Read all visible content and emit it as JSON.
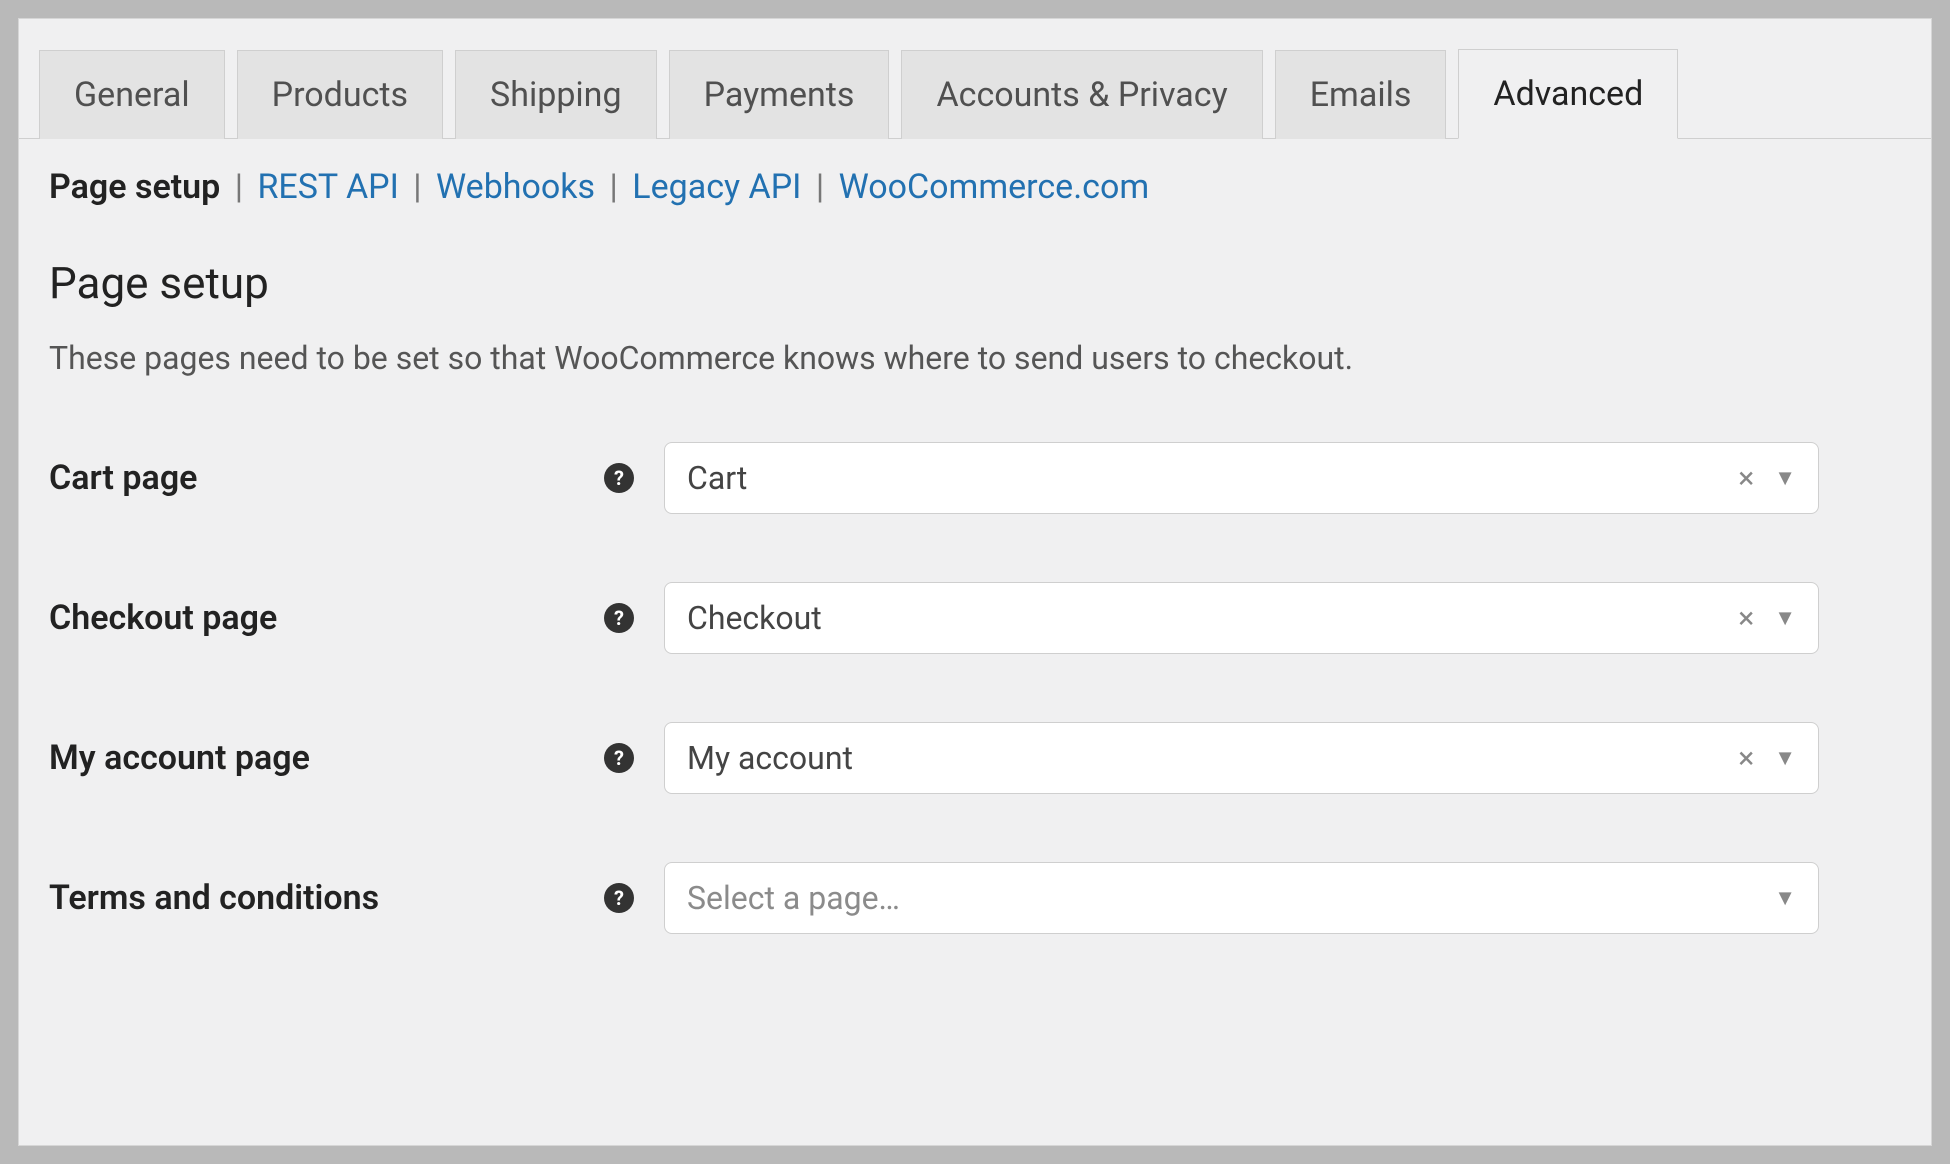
{
  "tabs": [
    {
      "label": "General",
      "active": false
    },
    {
      "label": "Products",
      "active": false
    },
    {
      "label": "Shipping",
      "active": false
    },
    {
      "label": "Payments",
      "active": false
    },
    {
      "label": "Accounts & Privacy",
      "active": false
    },
    {
      "label": "Emails",
      "active": false
    },
    {
      "label": "Advanced",
      "active": true
    }
  ],
  "subnav": {
    "current": "Page setup",
    "items": [
      {
        "label": "REST API"
      },
      {
        "label": "Webhooks"
      },
      {
        "label": "Legacy API"
      },
      {
        "label": "WooCommerce.com"
      }
    ]
  },
  "section": {
    "title": "Page setup",
    "description": "These pages need to be set so that WooCommerce knows where to send users to checkout."
  },
  "fields": {
    "cart": {
      "label": "Cart page",
      "value": "Cart",
      "placeholder": "",
      "clearable": true
    },
    "checkout": {
      "label": "Checkout page",
      "value": "Checkout",
      "placeholder": "",
      "clearable": true
    },
    "myaccount": {
      "label": "My account page",
      "value": "My account",
      "placeholder": "",
      "clearable": true
    },
    "terms": {
      "label": "Terms and conditions",
      "value": "",
      "placeholder": "Select a page…",
      "clearable": false
    }
  },
  "icons": {
    "help_tooltip": "?",
    "clear": "×",
    "caret": "▼"
  }
}
